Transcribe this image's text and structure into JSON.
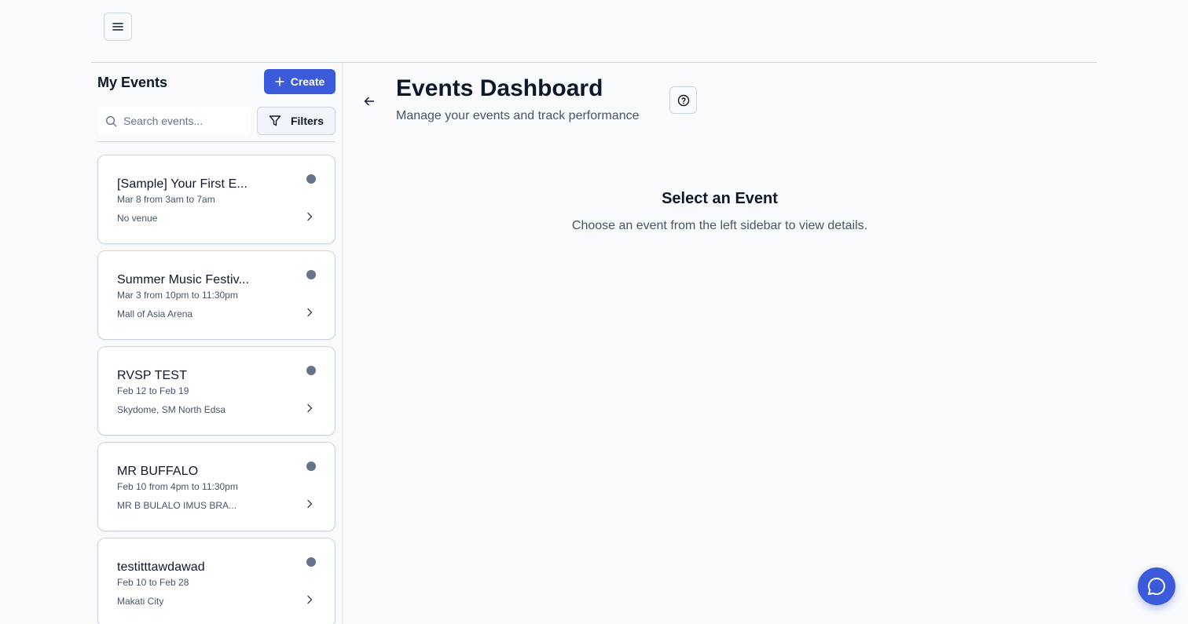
{
  "header": {
    "menu_icon": "hamburger-menu-icon"
  },
  "sidebar": {
    "title": "My Events",
    "create_label": "Create",
    "search_placeholder": "Search events...",
    "search_value": "",
    "filters_label": "Filters",
    "events": [
      {
        "name": "[Sample] Your First E...",
        "date": "Mar 8 from 3am to 7am",
        "venue": "No venue"
      },
      {
        "name": "Summer Music Festiv...",
        "date": "Mar 3 from 10pm to 11:30pm",
        "venue": "Mall of Asia Arena"
      },
      {
        "name": "RVSP TEST",
        "date": "Feb 12 to Feb 19",
        "venue": "Skydome, SM North Edsa"
      },
      {
        "name": "MR BUFFALO",
        "date": "Feb 10 from 4pm to 11:30pm",
        "venue": "MR B BULALO IMUS BRA..."
      },
      {
        "name": "testitttawdawad",
        "date": "Feb 10 to Feb 28",
        "venue": "Makati City"
      }
    ]
  },
  "main": {
    "title": "Events Dashboard",
    "subtitle": "Manage your events and track performance",
    "empty_title": "Select an Event",
    "empty_text": "Choose an event from the left sidebar to view details."
  },
  "colors": {
    "accent": "#3b5bdb",
    "background": "#f8fafc",
    "status_dot": "#64748b"
  }
}
